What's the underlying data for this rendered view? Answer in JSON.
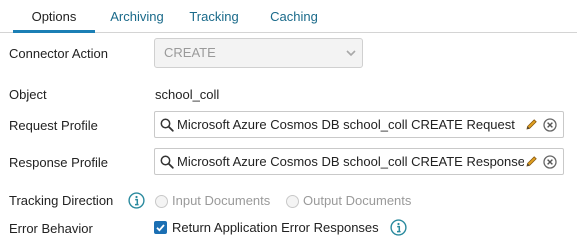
{
  "tabs": [
    {
      "label": "Options"
    },
    {
      "label": "Archiving"
    },
    {
      "label": "Tracking"
    },
    {
      "label": "Caching"
    }
  ],
  "form": {
    "connector_action": {
      "label": "Connector Action",
      "value": "CREATE"
    },
    "object": {
      "label": "Object",
      "value": "school_coll"
    },
    "request_profile": {
      "label": "Request Profile",
      "value": "Microsoft Azure Cosmos DB school_coll CREATE Request"
    },
    "response_profile": {
      "label": "Response Profile",
      "value": "Microsoft Azure Cosmos DB school_coll CREATE Response"
    },
    "tracking_direction": {
      "label": "Tracking Direction",
      "options": [
        "Input Documents",
        "Output Documents"
      ]
    },
    "error_behavior": {
      "label": "Error Behavior",
      "checkbox_label": "Return Application Error Responses",
      "checked": true
    }
  },
  "colors": {
    "accent": "#1b7fb5",
    "tab_text": "#1a6a8a",
    "info_icon": "#2a8a9e",
    "pencil": "#e0a020",
    "checkbox": "#1b6fb3"
  }
}
